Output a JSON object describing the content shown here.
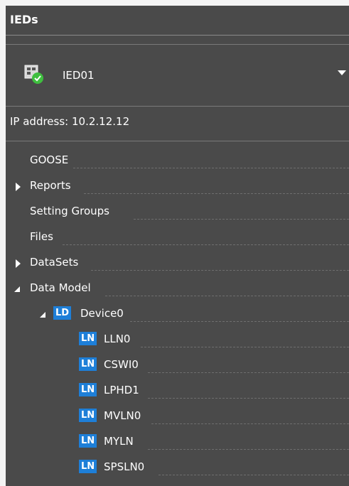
{
  "panel": {
    "title": "IEDs"
  },
  "device_selector": {
    "selected": "IED01"
  },
  "ip": {
    "label": "IP address:",
    "value": "10.2.12.12"
  },
  "tree": {
    "goose": "GOOSE",
    "reports": "Reports",
    "setting_groups": "Setting Groups",
    "files": "Files",
    "datasets": "DataSets",
    "data_model": "Data Model",
    "ld": {
      "badge": "LD",
      "name": "Device0"
    },
    "ln_badge": "LN",
    "ln_nodes": [
      "LLN0",
      "CSWI0",
      "LPHD1",
      "MVLN0",
      "MYLN",
      "SPSLN0"
    ]
  },
  "colors": {
    "panel_bg": "#4a4a4a",
    "badge_blue": "#1e7fd8",
    "status_green": "#3fbf3f"
  }
}
